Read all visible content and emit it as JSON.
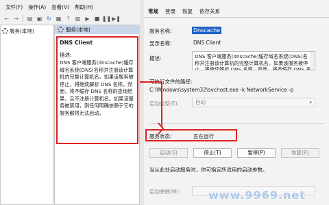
{
  "mmc": {
    "menu": [
      "文件(F)",
      "操作(A)",
      "查看(V)",
      "帮助(H)"
    ],
    "toolbar_icons": [
      "back-icon",
      "forward-icon",
      "up-icon",
      "console-icon",
      "refresh-icon",
      "export-icon",
      "help-icon",
      "properties-icon",
      "play-icon",
      "stop-icon",
      "pause-icon",
      "restart-icon"
    ],
    "tree_item": "服务(本地)",
    "content_header": "服务(本地)",
    "service_title": "DNS Client",
    "description_label": "描述:",
    "description_text": "DNS 客户端服务(dnscache)缓存域名系统(DNS)名称并注册该计算机的完整计算机名。如果该服务被停止，将继续解析 DNS 名称。然而，将不缓存 DNS 名称的查询结果，且不注册计算机名。如果该服务被禁用，则任何明确依赖于它的服务都将无法启动。"
  },
  "dialog": {
    "tabs": [
      "常规",
      "登录",
      "恢复",
      "依存关系"
    ],
    "active_tab": "常规",
    "service_name_label": "服务名称:",
    "service_name_value": "Dnscache",
    "display_name_label": "显示名称:",
    "display_name_value": "DNS Client",
    "description_label": "描述:",
    "description_value": "DNS 客户端服务(dnscache)缓存域名系统(DNS)名称并注册该计算机的完整计算机名。如果该服务被停止，将继续解析 DNS 名称。然而，将不缓存 DNS 名称的查询结果",
    "exe_path_label": "可执行文件的路径:",
    "exe_path_value": "C:\\Windows\\system32\\svchost.exe -k NetworkService -p",
    "startup_type_label": "启动类型(E):",
    "startup_type_value": "自动",
    "status_label": "服务状态:",
    "status_value": "正在运行",
    "buttons": {
      "start": "启动(S)",
      "stop": "停止(T)",
      "pause": "暂停(P)",
      "resume": "恢复(R)"
    },
    "hint": "当从此处启动服务时，你可指定所适用的启动参数。",
    "start_params_label": "启动参数(M):"
  },
  "watermark": "www.9969.net",
  "colors": {
    "highlight_box": "#e02020",
    "selection": "#1e5fc8",
    "header_bg": "#c8d7ea"
  }
}
